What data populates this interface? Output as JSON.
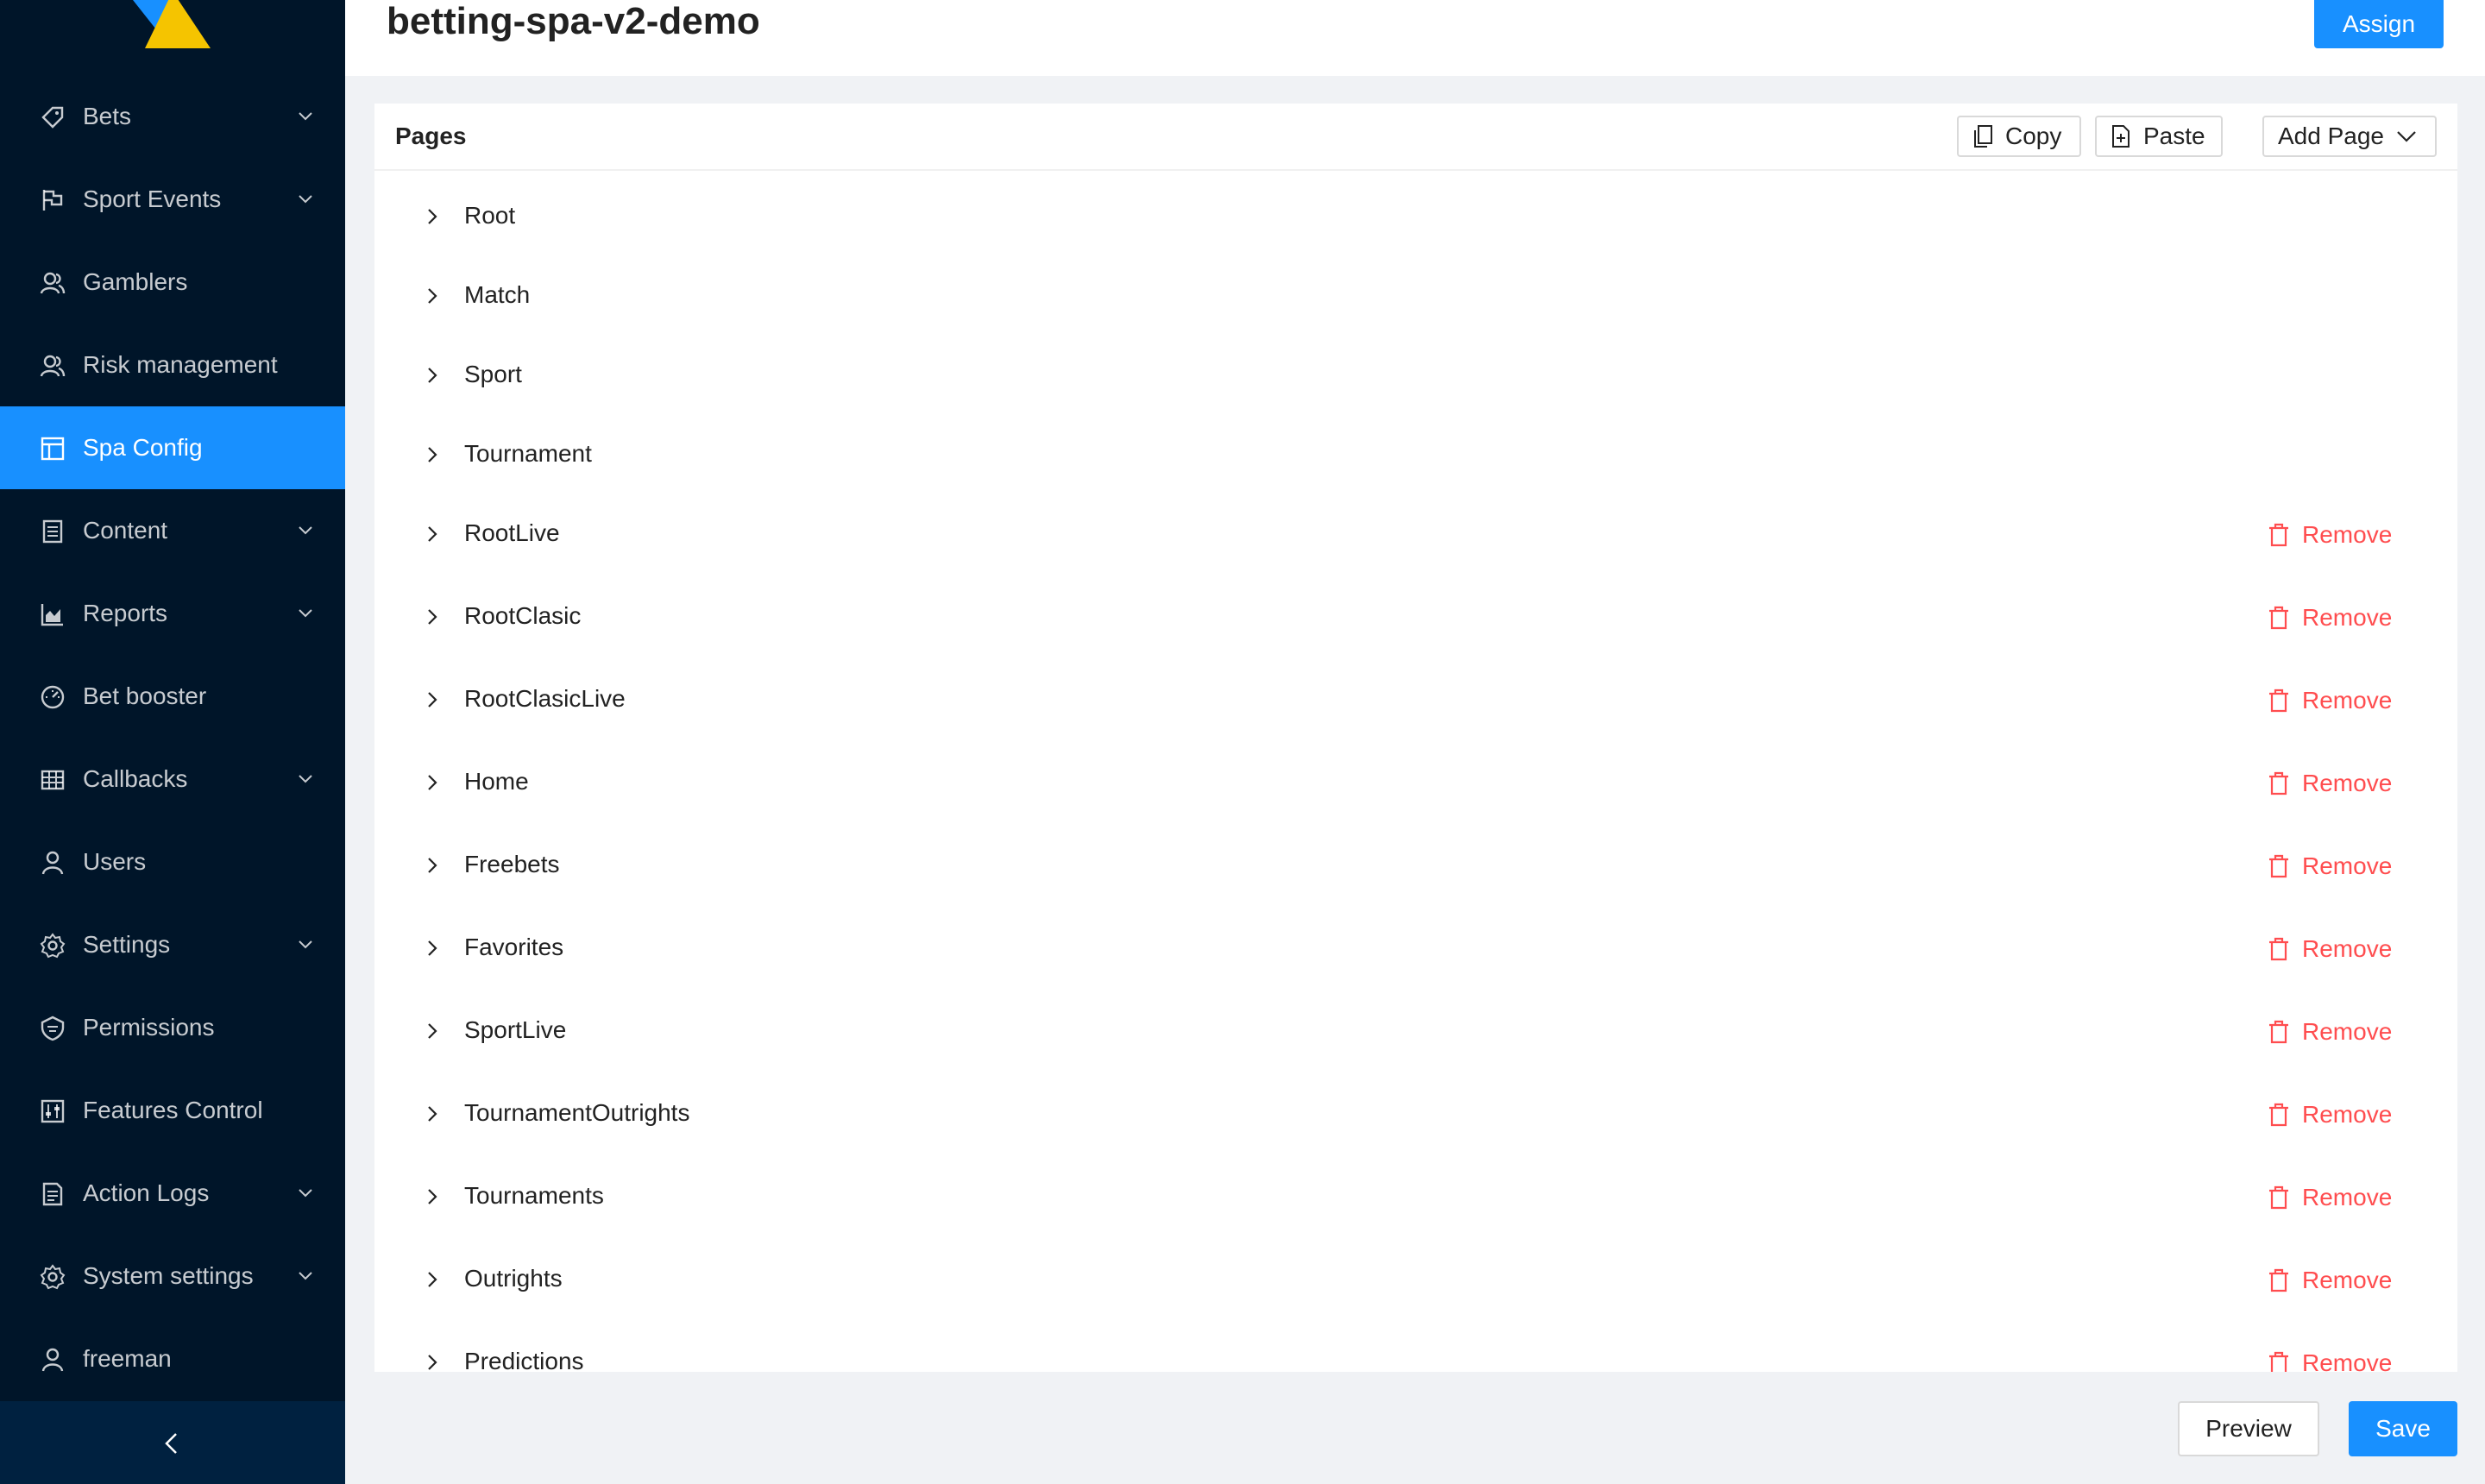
{
  "sidebar": {
    "items": [
      {
        "label": "Bets",
        "icon": "tag-icon",
        "has_submenu": true
      },
      {
        "label": "Sport Events",
        "icon": "flag-icon",
        "has_submenu": true
      },
      {
        "label": "Gamblers",
        "icon": "users-icon",
        "has_submenu": false
      },
      {
        "label": "Risk management",
        "icon": "users-icon",
        "has_submenu": false
      },
      {
        "label": "Spa Config",
        "icon": "layout-icon",
        "has_submenu": false,
        "active": true
      },
      {
        "label": "Content",
        "icon": "document-icon",
        "has_submenu": true
      },
      {
        "label": "Reports",
        "icon": "area-chart-icon",
        "has_submenu": true
      },
      {
        "label": "Bet booster",
        "icon": "dashboard-icon",
        "has_submenu": false
      },
      {
        "label": "Callbacks",
        "icon": "table-icon",
        "has_submenu": true
      },
      {
        "label": "Users",
        "icon": "user-icon",
        "has_submenu": false
      },
      {
        "label": "Settings",
        "icon": "gear-icon",
        "has_submenu": true
      },
      {
        "label": "Permissions",
        "icon": "safety-icon",
        "has_submenu": false
      },
      {
        "label": "Features Control",
        "icon": "control-icon",
        "has_submenu": false
      },
      {
        "label": "Action Logs",
        "icon": "file-text-icon",
        "has_submenu": true
      },
      {
        "label": "System settings",
        "icon": "gear-icon",
        "has_submenu": true
      },
      {
        "label": "freeman",
        "icon": "user-icon",
        "has_submenu": false
      }
    ]
  },
  "header": {
    "title": "betting-spa-v2-demo",
    "assign_label": "Assign"
  },
  "card": {
    "title": "Pages",
    "copy_label": "Copy",
    "paste_label": "Paste",
    "add_page_label": "Add Page",
    "remove_label": "Remove",
    "pages": [
      {
        "name": "Root",
        "removable": false
      },
      {
        "name": "Match",
        "removable": false
      },
      {
        "name": "Sport",
        "removable": false
      },
      {
        "name": "Tournament",
        "removable": false
      },
      {
        "name": "RootLive",
        "removable": true
      },
      {
        "name": "RootClasic",
        "removable": true
      },
      {
        "name": "RootClasicLive",
        "removable": true
      },
      {
        "name": "Home",
        "removable": true
      },
      {
        "name": "Freebets",
        "removable": true
      },
      {
        "name": "Favorites",
        "removable": true
      },
      {
        "name": "SportLive",
        "removable": true
      },
      {
        "name": "TournamentOutrights",
        "removable": true
      },
      {
        "name": "Tournaments",
        "removable": true
      },
      {
        "name": "Outrights",
        "removable": true
      },
      {
        "name": "Predictions",
        "removable": true
      }
    ]
  },
  "footer": {
    "preview_label": "Preview",
    "save_label": "Save"
  },
  "colors": {
    "sidebar_bg": "#001529",
    "accent": "#1890ff",
    "danger": "#ff4d4f"
  }
}
